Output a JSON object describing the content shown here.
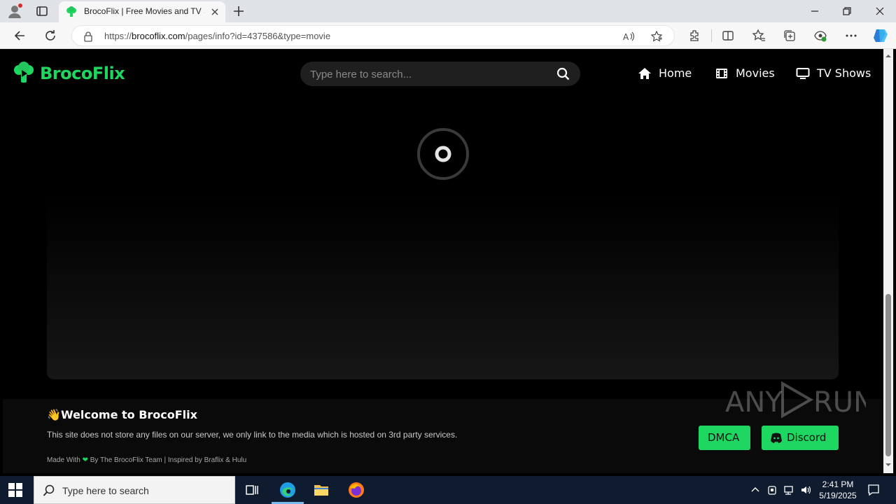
{
  "browser": {
    "tab": {
      "title": "BrocoFlix | Free Movies and TV Shows"
    },
    "address": {
      "url_prefix": "https://",
      "url_domain": "brocoflix.com",
      "url_path": "/pages/info?id=437586&type=movie"
    }
  },
  "site": {
    "brand": "BrocoFlix",
    "search_placeholder": "Type here to search...",
    "nav": [
      {
        "label": "Home",
        "icon": "home-icon"
      },
      {
        "label": "Movies",
        "icon": "film-icon"
      },
      {
        "label": "TV Shows",
        "icon": "tv-icon"
      }
    ]
  },
  "footer": {
    "welcome": "Welcome to BrocoFlix",
    "description": "This site does not store any files on our server, we only link to the media which is hosted on 3rd party services.",
    "made_prefix": "Made With",
    "made_suffix": "By The BrocoFlix Team | Inspired by Braflix & Hulu",
    "buttons": [
      {
        "label": "DMCA"
      },
      {
        "label": "Discord"
      }
    ]
  },
  "watermark": "ANY RUN",
  "taskbar": {
    "search_placeholder": "Type here to search",
    "time": "2:41 PM",
    "date": "5/19/2025"
  },
  "colors": {
    "brand_green": "#1ed760",
    "taskbar": "#0f1b2e"
  }
}
